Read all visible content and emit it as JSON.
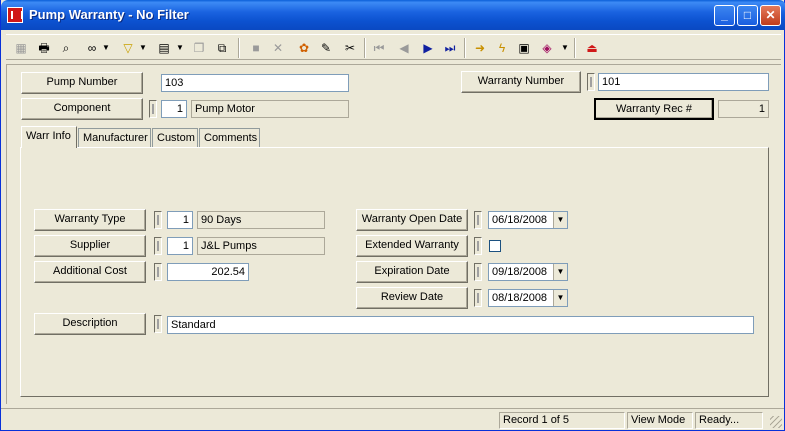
{
  "window": {
    "title": "Pump Warranty - No Filter",
    "buttons": {
      "minimize": "_",
      "maximize": "□",
      "close": "✕"
    },
    "colors": {
      "titlebar": "#0a52d0",
      "close": "#c03c1c",
      "face": "#ece9d8"
    }
  },
  "toolbar": {
    "icons": [
      "table-icon",
      "print-icon",
      "print-preview-icon",
      "binoculars-icon",
      "filter-icon",
      "new-record-icon",
      "copy-icon",
      "copy-record-icon",
      "save-icon",
      "delete-icon",
      "spellcheck-icon",
      "edit-icon",
      "cut-icon",
      "first-record-icon",
      "prev-record-icon",
      "next-record-icon",
      "last-record-icon",
      "goto-icon",
      "lightning-icon",
      "report-icon",
      "books-icon",
      "exit-icon"
    ]
  },
  "header": {
    "pump_number": {
      "label": "Pump Number",
      "value": "103"
    },
    "warranty_number": {
      "label": "Warranty Number",
      "value": "101"
    },
    "component": {
      "label": "Component",
      "code": "1",
      "name": "Pump Motor"
    },
    "warranty_rec": {
      "label": "Warranty Rec #",
      "value": "1"
    }
  },
  "tabs": [
    "Warr Info",
    "Manufacturer",
    "Custom",
    "Comments"
  ],
  "warr_info": {
    "warranty_type": {
      "label": "Warranty Type",
      "code": "1",
      "name": "90 Days"
    },
    "supplier": {
      "label": "Supplier",
      "code": "1",
      "name": "J&L Pumps"
    },
    "additional_cost": {
      "label": "Additional Cost",
      "value": "202.54"
    },
    "warranty_open_date": {
      "label": "Warranty Open Date",
      "value": "06/18/2008"
    },
    "extended_warranty": {
      "label": "Extended Warranty",
      "checked": false
    },
    "expiration_date": {
      "label": "Expiration Date",
      "value": "09/18/2008"
    },
    "review_date": {
      "label": "Review Date",
      "value": "08/18/2008"
    },
    "description": {
      "label": "Description",
      "value": "Standard"
    }
  },
  "status": {
    "record": "Record 1 of 5",
    "mode": "View Mode",
    "state": "Ready..."
  }
}
